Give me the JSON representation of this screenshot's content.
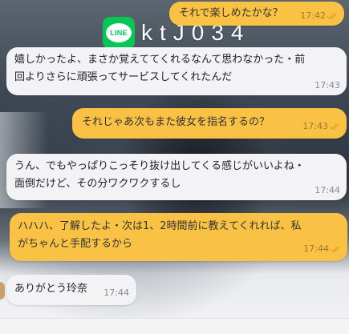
{
  "watermark": {
    "logo_text": "LINE",
    "account_id": "ktJ034"
  },
  "colors": {
    "sent_bubble": "#f9c245",
    "received_bubble": "#f3f3f5",
    "read_check": "#e5a41c",
    "line_green": "#06c755"
  },
  "messages": [
    {
      "side": "sent",
      "text": "それで楽しめたかな？",
      "time": "17:42",
      "read_icon": "double-check-icon"
    },
    {
      "side": "received",
      "text": "嬉しかったよ、まさか覚えててくれるなんて思わなかった・前回よりさらに頑張ってサービスしてくれたんだ",
      "time": "17:43"
    },
    {
      "side": "sent",
      "text": "それじゃあ次もまた彼女を指名するの？",
      "time": "17:43",
      "read_icon": "double-check-icon"
    },
    {
      "side": "received",
      "text": "うん、でもやっぱりこっそり抜け出してくる感じがいいよね・面倒だけど、その分ワクワクするし",
      "time": "17:44"
    },
    {
      "side": "sent",
      "text": "ハハハ、了解したよ・次は1、2時間前に教えてくれれば、私がちゃんと手配するから",
      "time": "17:44",
      "read_icon": "double-check-icon"
    },
    {
      "side": "received",
      "text": "ありがとう玲奈",
      "time": "17:44"
    }
  ]
}
